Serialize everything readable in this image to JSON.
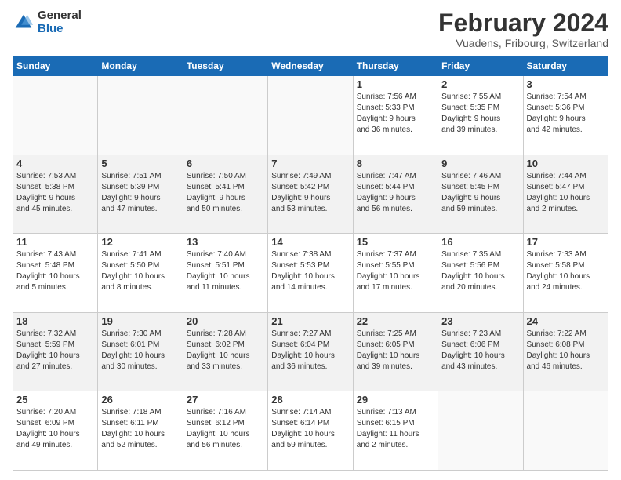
{
  "logo": {
    "general": "General",
    "blue": "Blue"
  },
  "title": {
    "month_year": "February 2024",
    "location": "Vuadens, Fribourg, Switzerland"
  },
  "days_of_week": [
    "Sunday",
    "Monday",
    "Tuesday",
    "Wednesday",
    "Thursday",
    "Friday",
    "Saturday"
  ],
  "weeks": [
    {
      "shaded": false,
      "days": [
        {
          "num": "",
          "info": ""
        },
        {
          "num": "",
          "info": ""
        },
        {
          "num": "",
          "info": ""
        },
        {
          "num": "",
          "info": ""
        },
        {
          "num": "1",
          "info": "Sunrise: 7:56 AM\nSunset: 5:33 PM\nDaylight: 9 hours\nand 36 minutes."
        },
        {
          "num": "2",
          "info": "Sunrise: 7:55 AM\nSunset: 5:35 PM\nDaylight: 9 hours\nand 39 minutes."
        },
        {
          "num": "3",
          "info": "Sunrise: 7:54 AM\nSunset: 5:36 PM\nDaylight: 9 hours\nand 42 minutes."
        }
      ]
    },
    {
      "shaded": true,
      "days": [
        {
          "num": "4",
          "info": "Sunrise: 7:53 AM\nSunset: 5:38 PM\nDaylight: 9 hours\nand 45 minutes."
        },
        {
          "num": "5",
          "info": "Sunrise: 7:51 AM\nSunset: 5:39 PM\nDaylight: 9 hours\nand 47 minutes."
        },
        {
          "num": "6",
          "info": "Sunrise: 7:50 AM\nSunset: 5:41 PM\nDaylight: 9 hours\nand 50 minutes."
        },
        {
          "num": "7",
          "info": "Sunrise: 7:49 AM\nSunset: 5:42 PM\nDaylight: 9 hours\nand 53 minutes."
        },
        {
          "num": "8",
          "info": "Sunrise: 7:47 AM\nSunset: 5:44 PM\nDaylight: 9 hours\nand 56 minutes."
        },
        {
          "num": "9",
          "info": "Sunrise: 7:46 AM\nSunset: 5:45 PM\nDaylight: 9 hours\nand 59 minutes."
        },
        {
          "num": "10",
          "info": "Sunrise: 7:44 AM\nSunset: 5:47 PM\nDaylight: 10 hours\nand 2 minutes."
        }
      ]
    },
    {
      "shaded": false,
      "days": [
        {
          "num": "11",
          "info": "Sunrise: 7:43 AM\nSunset: 5:48 PM\nDaylight: 10 hours\nand 5 minutes."
        },
        {
          "num": "12",
          "info": "Sunrise: 7:41 AM\nSunset: 5:50 PM\nDaylight: 10 hours\nand 8 minutes."
        },
        {
          "num": "13",
          "info": "Sunrise: 7:40 AM\nSunset: 5:51 PM\nDaylight: 10 hours\nand 11 minutes."
        },
        {
          "num": "14",
          "info": "Sunrise: 7:38 AM\nSunset: 5:53 PM\nDaylight: 10 hours\nand 14 minutes."
        },
        {
          "num": "15",
          "info": "Sunrise: 7:37 AM\nSunset: 5:55 PM\nDaylight: 10 hours\nand 17 minutes."
        },
        {
          "num": "16",
          "info": "Sunrise: 7:35 AM\nSunset: 5:56 PM\nDaylight: 10 hours\nand 20 minutes."
        },
        {
          "num": "17",
          "info": "Sunrise: 7:33 AM\nSunset: 5:58 PM\nDaylight: 10 hours\nand 24 minutes."
        }
      ]
    },
    {
      "shaded": true,
      "days": [
        {
          "num": "18",
          "info": "Sunrise: 7:32 AM\nSunset: 5:59 PM\nDaylight: 10 hours\nand 27 minutes."
        },
        {
          "num": "19",
          "info": "Sunrise: 7:30 AM\nSunset: 6:01 PM\nDaylight: 10 hours\nand 30 minutes."
        },
        {
          "num": "20",
          "info": "Sunrise: 7:28 AM\nSunset: 6:02 PM\nDaylight: 10 hours\nand 33 minutes."
        },
        {
          "num": "21",
          "info": "Sunrise: 7:27 AM\nSunset: 6:04 PM\nDaylight: 10 hours\nand 36 minutes."
        },
        {
          "num": "22",
          "info": "Sunrise: 7:25 AM\nSunset: 6:05 PM\nDaylight: 10 hours\nand 39 minutes."
        },
        {
          "num": "23",
          "info": "Sunrise: 7:23 AM\nSunset: 6:06 PM\nDaylight: 10 hours\nand 43 minutes."
        },
        {
          "num": "24",
          "info": "Sunrise: 7:22 AM\nSunset: 6:08 PM\nDaylight: 10 hours\nand 46 minutes."
        }
      ]
    },
    {
      "shaded": false,
      "days": [
        {
          "num": "25",
          "info": "Sunrise: 7:20 AM\nSunset: 6:09 PM\nDaylight: 10 hours\nand 49 minutes."
        },
        {
          "num": "26",
          "info": "Sunrise: 7:18 AM\nSunset: 6:11 PM\nDaylight: 10 hours\nand 52 minutes."
        },
        {
          "num": "27",
          "info": "Sunrise: 7:16 AM\nSunset: 6:12 PM\nDaylight: 10 hours\nand 56 minutes."
        },
        {
          "num": "28",
          "info": "Sunrise: 7:14 AM\nSunset: 6:14 PM\nDaylight: 10 hours\nand 59 minutes."
        },
        {
          "num": "29",
          "info": "Sunrise: 7:13 AM\nSunset: 6:15 PM\nDaylight: 11 hours\nand 2 minutes."
        },
        {
          "num": "",
          "info": ""
        },
        {
          "num": "",
          "info": ""
        }
      ]
    }
  ]
}
